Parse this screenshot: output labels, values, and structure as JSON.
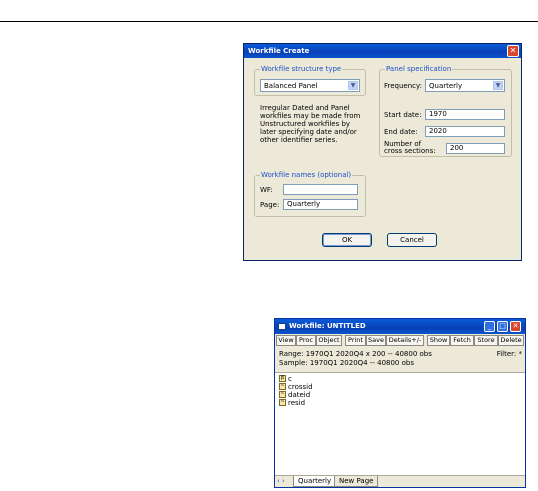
{
  "dialog": {
    "title": "Workfile Create",
    "structure_group_title": "Workfile structure type",
    "structure_type_value": "Balanced Panel",
    "note_text": "Irregular Dated and Panel workfiles may be made from Unstructured workfiles by later specifying date and/or other identifier series.",
    "panel_group_title": "Panel specification",
    "frequency_label": "Frequency:",
    "frequency_value": "Quarterly",
    "start_date_label": "Start date:",
    "start_date_value": "1970",
    "end_date_label": "End date:",
    "end_date_value": "2020",
    "cross_sections_label_1": "Number of",
    "cross_sections_label_2": "cross sections:",
    "cross_sections_value": "200",
    "names_group_title": "Workfile names (optional)",
    "wf_label": "WF:",
    "wf_value": "",
    "page_label": "Page:",
    "page_value": "Quarterly",
    "ok_label": "OK",
    "cancel_label": "Cancel",
    "close_glyph": "✕"
  },
  "workfile": {
    "title": "Workfile: UNTITLED",
    "toolbar": [
      "View",
      "Proc",
      "Object",
      "Print",
      "Save",
      "Details+/-",
      "Show",
      "Fetch",
      "Store",
      "Delete"
    ],
    "range_text": "Range:  1970Q1 2020Q4 x 200  --  40800 obs",
    "sample_text": "Sample: 1970Q1 2020Q4  --  40800 obs",
    "filter_text": "Filter: *",
    "objects": [
      "c",
      "crossid",
      "dateid",
      "resid"
    ],
    "tabs": [
      "Quarterly",
      "New Page"
    ],
    "nav_glyph": "‹ ›"
  },
  "colors": {
    "titlebar": "#0a54cc",
    "dialog_bg": "#ece9d8",
    "group_title": "#1c4fc7",
    "close": "#d9462b"
  }
}
